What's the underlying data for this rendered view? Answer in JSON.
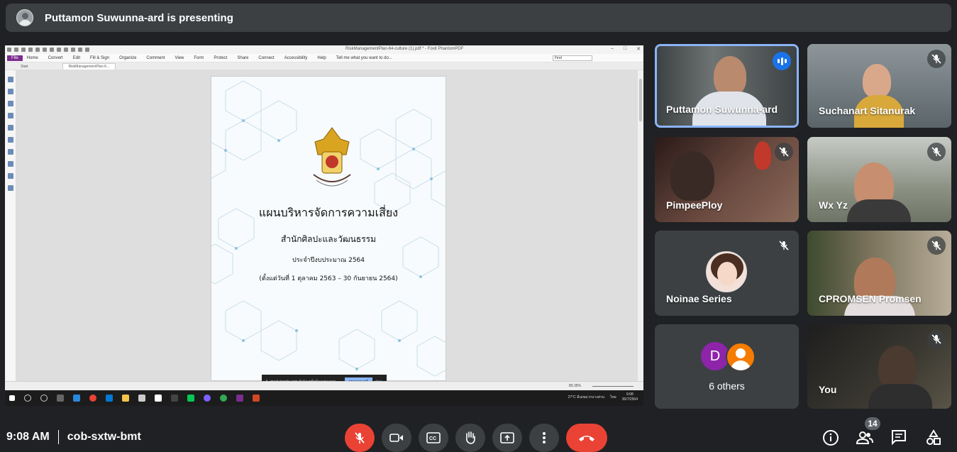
{
  "banner": {
    "presenting_text": "Puttamon Suwunna-ard is presenting"
  },
  "shared_screen": {
    "window_title": "RiskManagementPlan-64-culture (1).pdf * - Foxit PhantomPDF",
    "menu": [
      "File",
      "Home",
      "Convert",
      "Edit",
      "Fill & Sign",
      "Organize",
      "Comment",
      "View",
      "Form",
      "Protect",
      "Share",
      "Connect",
      "Accessibility",
      "Help"
    ],
    "tell_me": "Tell me what you want to do...",
    "find_placeholder": "Find",
    "tabs": [
      "Start",
      "RiskManagementPlan-6..."
    ],
    "document": {
      "title": "แผนบริหารจัดการความเสี่ยง",
      "office": "สำนักศิลปะและวัฒนธรรม",
      "fiscal_year": "ประจำปีงบประมาณ 2564",
      "period": "(ตั้งแต่วันที่ 1 ตุลาคม 2563 – 30 กันยายน 2564)"
    },
    "notification": {
      "text": "meet.google.com กำลังแชร์หน้าจอของคุณ",
      "stop_label": "หยุดการแชร์",
      "hide_label": "ซ่อน"
    },
    "zoom": "80.35%",
    "taskbar": {
      "weather": "27°C มีเมฆมากบางส่วน",
      "time": "9:08",
      "date": "30/7/2564",
      "lang": "ไทย"
    }
  },
  "participants": [
    {
      "name": "Puttamon Suwunna-ard",
      "speaking": true
    },
    {
      "name": "Suchanart Sitanurak",
      "muted": true
    },
    {
      "name": "PimpeePloy",
      "muted": true
    },
    {
      "name": "Wx Yz",
      "muted": true
    },
    {
      "name": "Noinae Series",
      "muted": true
    },
    {
      "name": "CPROMSEN Promsen",
      "muted": true
    },
    {
      "name": "6 others",
      "avatar_letter": "D"
    },
    {
      "name": "You",
      "muted": true
    }
  ],
  "bottom_bar": {
    "time": "9:08 AM",
    "meeting_code": "cob-sxtw-bmt",
    "participant_count": "14"
  },
  "colors": {
    "background": "#202124",
    "tile": "#3c4043",
    "end_call": "#ea4335",
    "speaking": "#8ab4f8"
  }
}
